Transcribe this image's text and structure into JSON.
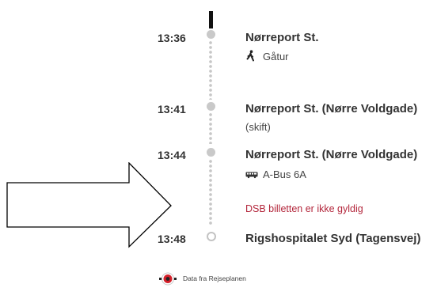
{
  "journey": {
    "top_clipped_text": "ˉ ˉ ˉ ˉ",
    "stops": [
      {
        "time": "13:36",
        "name": "Nørreport St."
      },
      {
        "time": "13:41",
        "name": "Nørreport St. (Nørre Voldgade)"
      },
      {
        "time": "13:44",
        "name": "Nørreport St. (Nørre Voldgade)"
      },
      {
        "time": "13:48",
        "name": "Rigshospitalet Syd (Tagensvej)"
      }
    ],
    "walk_label": "Gåtur",
    "transfer_label": "(skift)",
    "bus_label": "A-Bus 6A",
    "ticket_warning": "DSB billetten er ikke gyldig"
  },
  "footer": {
    "source_label": "Data fra Rejseplanen"
  },
  "colors": {
    "warning": "#b3263b",
    "track_dot": "#c7c7c7",
    "logo_red": "#d4202a"
  },
  "icons": {
    "walk": "walking-person-icon",
    "bus": "bus-icon",
    "logo": "rejseplanen-logo",
    "arrow": "right-arrow-outline"
  }
}
